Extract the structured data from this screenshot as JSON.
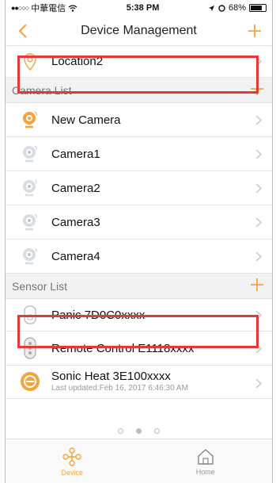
{
  "status_bar": {
    "carrier": "中華電信",
    "time": "5:38 PM",
    "battery": "68%"
  },
  "header": {
    "title": "Device Management"
  },
  "location": {
    "label": "Location2"
  },
  "camera_section": {
    "title": "Camera List",
    "items": [
      {
        "label": "New Camera"
      },
      {
        "label": "Camera1"
      },
      {
        "label": "Camera2"
      },
      {
        "label": "Camera3"
      },
      {
        "label": "Camera4"
      }
    ]
  },
  "sensor_section": {
    "title": "Sensor List",
    "items": [
      {
        "label": "Panic 7D0C0xxxx"
      },
      {
        "label": "Remote Control E1118xxxx"
      },
      {
        "label": "Sonic Heat 3E100xxxx",
        "sublabel": "Last updated:Feb 16, 2017 6:46:30 AM"
      }
    ]
  },
  "pager": {
    "pages": 3,
    "active_index": 1
  },
  "tabbar": {
    "tabs": [
      {
        "label": "Device",
        "active": true
      },
      {
        "label": "Home",
        "active": false
      }
    ]
  },
  "colors": {
    "accent": "#f5a43d",
    "highlight": "#e53935",
    "section_bg": "#f2f2f2"
  }
}
